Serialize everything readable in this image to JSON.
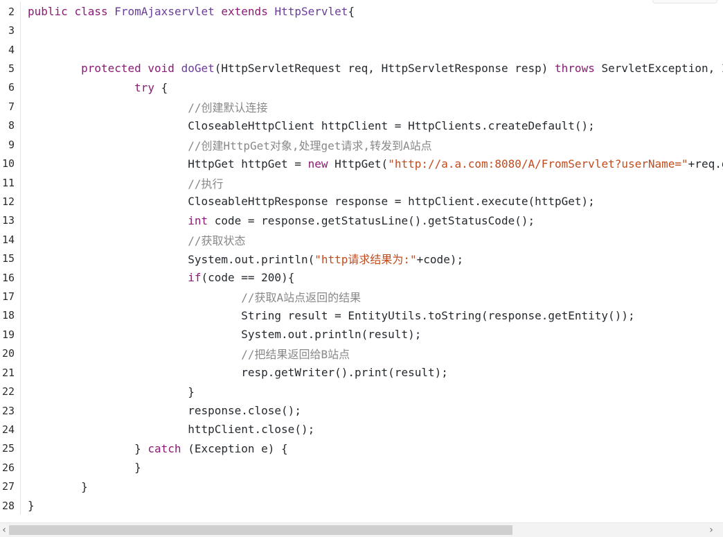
{
  "editor": {
    "lines": [
      {
        "n": "2",
        "tokens": [
          {
            "t": "kw",
            "v": "public"
          },
          {
            "t": "plain",
            "v": " "
          },
          {
            "t": "kw",
            "v": "class"
          },
          {
            "t": "plain",
            "v": " "
          },
          {
            "t": "cls",
            "v": "FromAjaxservlet"
          },
          {
            "t": "plain",
            "v": " "
          },
          {
            "t": "kw",
            "v": "extends"
          },
          {
            "t": "plain",
            "v": " "
          },
          {
            "t": "cls",
            "v": "HttpServlet"
          },
          {
            "t": "plain",
            "v": "{"
          }
        ]
      },
      {
        "n": "3",
        "tokens": []
      },
      {
        "n": "4",
        "tokens": []
      },
      {
        "n": "5",
        "tokens": [
          {
            "t": "plain",
            "v": "        "
          },
          {
            "t": "kw",
            "v": "protected"
          },
          {
            "t": "plain",
            "v": " "
          },
          {
            "t": "kw",
            "v": "void"
          },
          {
            "t": "plain",
            "v": " "
          },
          {
            "t": "cls",
            "v": "doGet"
          },
          {
            "t": "plain",
            "v": "(HttpServletRequest req, HttpServletResponse resp) "
          },
          {
            "t": "kw",
            "v": "throws"
          },
          {
            "t": "plain",
            "v": " ServletException, IOException {"
          }
        ]
      },
      {
        "n": "6",
        "tokens": [
          {
            "t": "plain",
            "v": "                "
          },
          {
            "t": "kw",
            "v": "try"
          },
          {
            "t": "plain",
            "v": " {"
          }
        ]
      },
      {
        "n": "7",
        "tokens": [
          {
            "t": "plain",
            "v": "                        "
          },
          {
            "t": "cmt",
            "v": "//创建默认连接"
          }
        ]
      },
      {
        "n": "8",
        "tokens": [
          {
            "t": "plain",
            "v": "                        CloseableHttpClient httpClient = HttpClients.createDefault();"
          }
        ]
      },
      {
        "n": "9",
        "tokens": [
          {
            "t": "plain",
            "v": "                        "
          },
          {
            "t": "cmt",
            "v": "//创建HttpGet对象,处理get请求,转发到A站点"
          }
        ]
      },
      {
        "n": "10",
        "tokens": [
          {
            "t": "plain",
            "v": "                        HttpGet httpGet = "
          },
          {
            "t": "kw",
            "v": "new"
          },
          {
            "t": "plain",
            "v": " HttpGet("
          },
          {
            "t": "str",
            "v": "\"http://a.a.com:8080/A/FromServlet?userName=\""
          },
          {
            "t": "plain",
            "v": "+req.getParameter(\"userName\"));"
          }
        ]
      },
      {
        "n": "11",
        "tokens": [
          {
            "t": "plain",
            "v": "                        "
          },
          {
            "t": "cmt",
            "v": "//执行"
          }
        ]
      },
      {
        "n": "12",
        "tokens": [
          {
            "t": "plain",
            "v": "                        CloseableHttpResponse response = httpClient.execute(httpGet);"
          }
        ]
      },
      {
        "n": "13",
        "tokens": [
          {
            "t": "plain",
            "v": "                        "
          },
          {
            "t": "kw",
            "v": "int"
          },
          {
            "t": "plain",
            "v": " code = response.getStatusLine().getStatusCode();"
          }
        ]
      },
      {
        "n": "14",
        "tokens": [
          {
            "t": "plain",
            "v": "                        "
          },
          {
            "t": "cmt",
            "v": "//获取状态"
          }
        ]
      },
      {
        "n": "15",
        "tokens": [
          {
            "t": "plain",
            "v": "                        System.out.println("
          },
          {
            "t": "str",
            "v": "\"http请求结果为:\""
          },
          {
            "t": "plain",
            "v": "+code);"
          }
        ]
      },
      {
        "n": "16",
        "tokens": [
          {
            "t": "plain",
            "v": "                        "
          },
          {
            "t": "kw",
            "v": "if"
          },
          {
            "t": "plain",
            "v": "(code == "
          },
          {
            "t": "num",
            "v": "200"
          },
          {
            "t": "plain",
            "v": "){"
          }
        ]
      },
      {
        "n": "17",
        "tokens": [
          {
            "t": "plain",
            "v": "                                "
          },
          {
            "t": "cmt",
            "v": "//获取A站点返回的结果"
          }
        ]
      },
      {
        "n": "18",
        "tokens": [
          {
            "t": "plain",
            "v": "                                String result = EntityUtils.toString(response.getEntity());"
          }
        ]
      },
      {
        "n": "19",
        "tokens": [
          {
            "t": "plain",
            "v": "                                System.out.println(result);"
          }
        ]
      },
      {
        "n": "20",
        "tokens": [
          {
            "t": "plain",
            "v": "                                "
          },
          {
            "t": "cmt",
            "v": "//把结果返回给B站点"
          }
        ]
      },
      {
        "n": "21",
        "tokens": [
          {
            "t": "plain",
            "v": "                                resp.getWriter().print(result);"
          }
        ]
      },
      {
        "n": "22",
        "tokens": [
          {
            "t": "plain",
            "v": "                        }"
          }
        ]
      },
      {
        "n": "23",
        "tokens": [
          {
            "t": "plain",
            "v": "                        response.close();"
          }
        ]
      },
      {
        "n": "24",
        "tokens": [
          {
            "t": "plain",
            "v": "                        httpClient.close();"
          }
        ]
      },
      {
        "n": "25",
        "tokens": [
          {
            "t": "plain",
            "v": "                } "
          },
          {
            "t": "kw",
            "v": "catch"
          },
          {
            "t": "plain",
            "v": " (Exception e) {"
          }
        ]
      },
      {
        "n": "26",
        "tokens": [
          {
            "t": "plain",
            "v": "                }"
          }
        ]
      },
      {
        "n": "27",
        "tokens": [
          {
            "t": "plain",
            "v": "        }"
          }
        ]
      },
      {
        "n": "28",
        "tokens": [
          {
            "t": "plain",
            "v": "}"
          }
        ]
      }
    ]
  },
  "scrollbar": {
    "left_arrow": "‹",
    "right_arrow": "›"
  }
}
